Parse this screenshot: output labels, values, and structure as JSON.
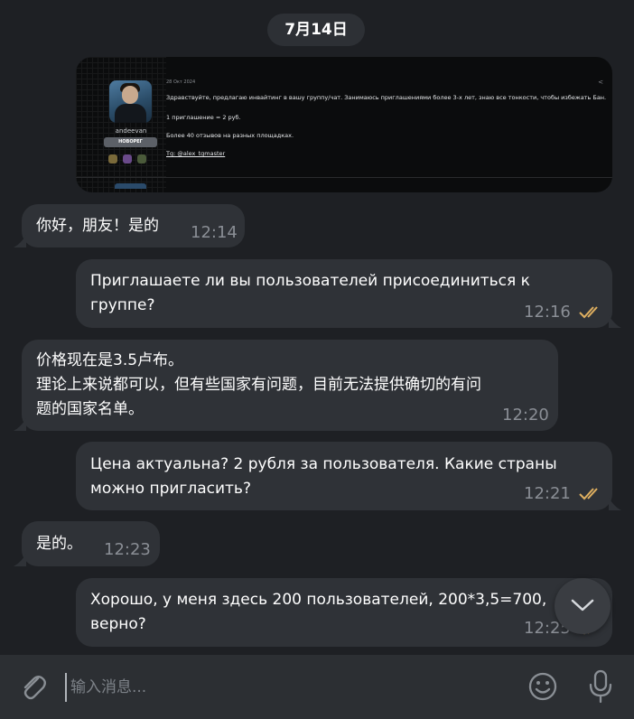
{
  "date_separator": "7月14日",
  "quoted_post": {
    "date": "28 Окт 2024",
    "username": "andeevan",
    "badge": "НОВОРЕГ",
    "lines": [
      "Здравствуйте, предлагаю инвайтинг в вашу группу/чат. Занимаюсь приглашениями более 3-х лет, знаю все тонкости, чтобы избежать Бан.",
      "1 приглашение = 2 руб.",
      "Более 40 отзывов на разных площадках.",
      "Tg: @alex_tgmaster"
    ]
  },
  "messages": [
    {
      "direction": "in",
      "text": "你好，朋友！是的",
      "time": "12:14"
    },
    {
      "direction": "out",
      "text_lines": [
        "Приглашаете ли вы пользователей присоединиться к",
        "группе?"
      ],
      "time": "12:16",
      "read": true
    },
    {
      "direction": "in",
      "text_lines": [
        "价格现在是3.5卢布。",
        "理论上来说都可以，但有些国家有问题，目前无法提供确切的有问",
        "题的国家名单。"
      ],
      "time": "12:20"
    },
    {
      "direction": "out",
      "text_lines": [
        "Цена актуальна? 2 рубля за пользователя. Какие страны",
        "можно пригласить?"
      ],
      "time": "12:21",
      "read": true
    },
    {
      "direction": "in",
      "text": "是的。",
      "time": "12:23"
    },
    {
      "direction": "out",
      "text_lines": [
        "Хорошо, у меня здесь 200 пользователей, 200*3,5=700,",
        "верно?"
      ],
      "time": "12:25",
      "read": true
    }
  ],
  "composer": {
    "placeholder": "输入消息..."
  },
  "icons": {
    "attach": "paperclip-icon",
    "emoji": "smile-icon",
    "mic": "microphone-icon",
    "scroll": "chevron-down-icon",
    "read_receipt": "double-check-icon"
  },
  "colors": {
    "background": "#1e2024",
    "bubble": "#2f3237",
    "read_check": "#e0b060",
    "timestamp": "#8a8e95"
  }
}
